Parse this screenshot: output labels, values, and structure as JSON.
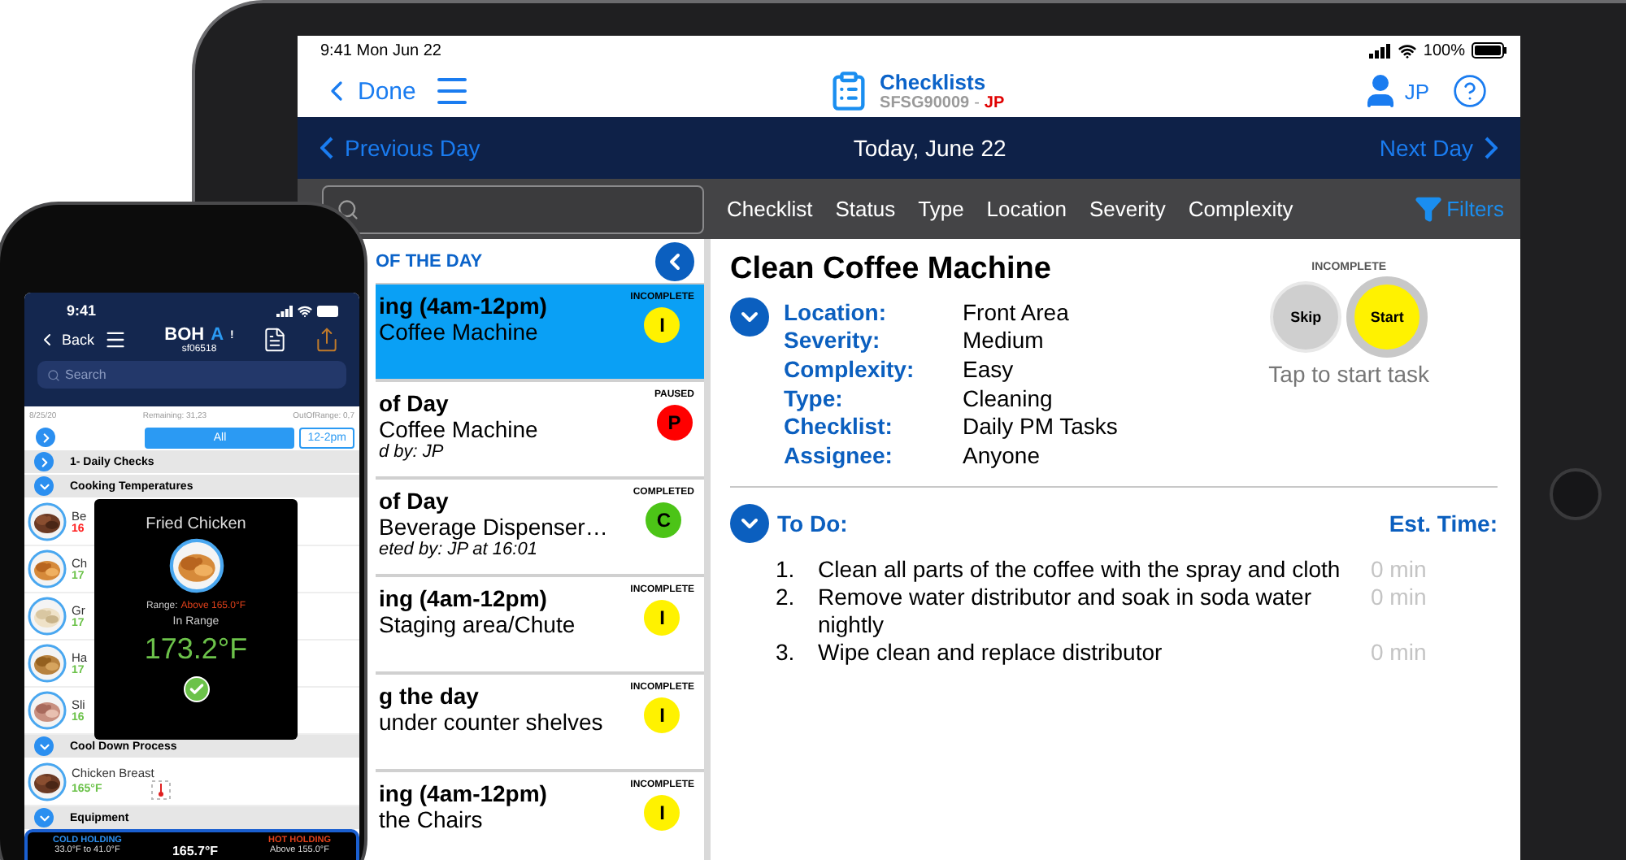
{
  "tablet": {
    "status_bar": {
      "time": "9:41  Mon Jun 22",
      "battery": "100%"
    },
    "header": {
      "back": "Done",
      "title": "Checklists",
      "subtitle": "SFSG90009",
      "separator": "-",
      "subtitle_user": "JP",
      "user": "JP"
    },
    "day_nav": {
      "previous": "Previous Day",
      "current": "Today, June 22",
      "next": "Next Day"
    },
    "filter_bar": {
      "filters": [
        "Checklist",
        "Status",
        "Type",
        "Location",
        "Severity",
        "Complexity"
      ],
      "filters_button": "Filters"
    },
    "task_list": {
      "header": "OF THE DAY",
      "tasks": [
        {
          "line_1": "ing (4am-12pm)",
          "line_2": "Coffee Machine",
          "status": "INCOMPLETE",
          "status_letter": "I",
          "color": "#fff200",
          "selected": true
        },
        {
          "line_1": "of Day",
          "line_2": "Coffee Machine",
          "line_3": "d by: JP",
          "status": "PAUSED",
          "status_letter": "P",
          "color": "#ff0000",
          "selected": false
        },
        {
          "line_1": "of Day",
          "line_2": "Beverage Dispenser…",
          "line_3": "eted by: JP at 16:01",
          "status": "COMPLETED",
          "status_letter": "C",
          "color": "#4cc417",
          "selected": false
        },
        {
          "line_1": "ing (4am-12pm)",
          "line_2": "Staging area/Chute",
          "status": "INCOMPLETE",
          "status_letter": "I",
          "color": "#fff200",
          "selected": false
        },
        {
          "line_1": "g the day",
          "line_2": "under counter shelves",
          "status": "INCOMPLETE",
          "status_letter": "I",
          "color": "#fff200",
          "selected": false
        },
        {
          "line_1": "ing (4am-12pm)",
          "line_2": "the Chairs",
          "status": "INCOMPLETE",
          "status_letter": "I",
          "color": "#fff200",
          "selected": false
        }
      ]
    },
    "detail": {
      "title": "Clean Coffee Machine",
      "details_expanded": true,
      "fields": [
        {
          "label": "Location:",
          "value": "Front Area"
        },
        {
          "label": "Severity:",
          "value": "Medium"
        },
        {
          "label": "Complexity:",
          "value": "Easy"
        },
        {
          "label": "Type:",
          "value": "Cleaning"
        },
        {
          "label": "Checklist:",
          "value": "Daily PM Tasks"
        },
        {
          "label": "Assignee:",
          "value": "Anyone"
        }
      ],
      "status": "INCOMPLETE",
      "skip": "Skip",
      "start": "Start",
      "hint": "Tap to start task",
      "todo": {
        "title": "To Do:",
        "time_header": "Est. Time:",
        "expanded": true,
        "items": [
          {
            "number": "1.",
            "text": "Clean all parts of the coffee with the spray and cloth",
            "time": "0 min"
          },
          {
            "number": "2.",
            "text": "Remove water distributor and soak in soda water nightly",
            "time": "0 min"
          },
          {
            "number": "3.",
            "text": "Wipe clean and replace distributor",
            "time": "0 min"
          }
        ]
      }
    }
  },
  "phone": {
    "status_bar": {
      "time": "9:41"
    },
    "header": {
      "back": "Back",
      "logo": "BOH",
      "logo_accent": "A",
      "logo_end": "!",
      "subtitle": "sf06518"
    },
    "search": {
      "placeholder": "Search"
    },
    "info": {
      "date": "8/25/20",
      "remaining": "Remaining: 31,23",
      "out_of_range": "OutOfRange: 0,7"
    },
    "segments": [
      {
        "label": "All",
        "selected": true
      },
      {
        "label": "12-2pm",
        "selected": false
      }
    ],
    "rows": [
      {
        "kind": "group",
        "label": "1- Daily Checks",
        "expanded": false
      },
      {
        "kind": "group",
        "label": "Cooking Temperatures",
        "expanded": true
      },
      {
        "kind": "item",
        "name": "Be",
        "reading": "16",
        "in_range": false
      },
      {
        "kind": "item",
        "name": "Ch",
        "reading": "17",
        "in_range": true
      },
      {
        "kind": "item",
        "name": "Gr",
        "reading": "17",
        "in_range": true
      },
      {
        "kind": "item",
        "name": "Ha",
        "reading": "17",
        "in_range": true
      },
      {
        "kind": "item",
        "name": "Sli",
        "reading": "16",
        "in_range": true
      },
      {
        "kind": "group",
        "label": "Cool Down Process",
        "expanded": true
      },
      {
        "kind": "item",
        "name": "Chicken Breast",
        "reading": "165°F",
        "in_range": true,
        "thermometer": true
      },
      {
        "kind": "group",
        "label": "Equipment",
        "expanded": true
      }
    ],
    "popup": {
      "title": "Fried Chicken",
      "range_label": "Range:",
      "range_value": "Above 165.0°F",
      "status": "In Range",
      "reading": "173.2°F"
    },
    "holding_bar": {
      "cold_label": "COLD HOLDING",
      "cold_range": "33.0°F to 41.0°F",
      "reading": "165.7°F",
      "hot_label": "HOT HOLDING",
      "hot_range": "Above 155.0°F"
    }
  }
}
